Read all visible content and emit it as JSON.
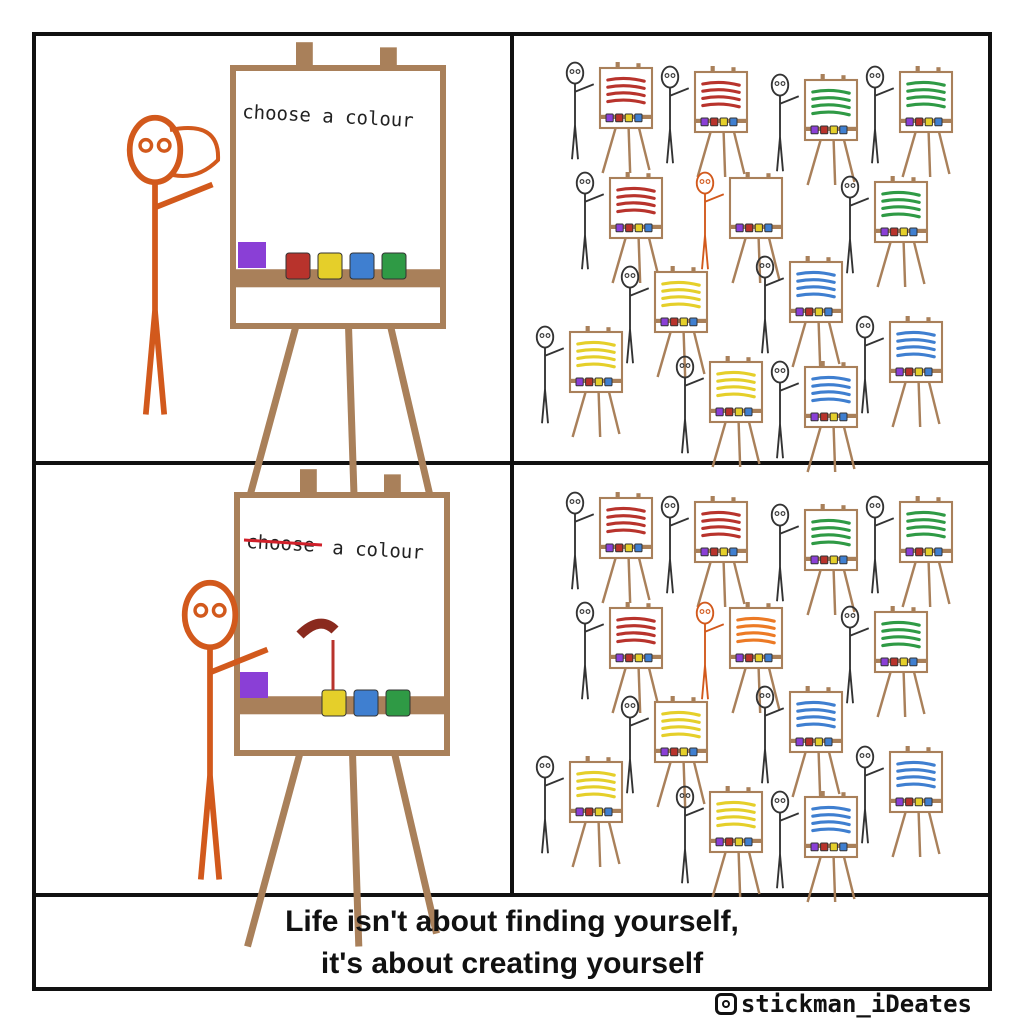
{
  "panels": {
    "top_left": {
      "easel_text": "choose a colour"
    },
    "bottom_left": {
      "easel_text_struck": "choose",
      "easel_text_rest": "a colour"
    }
  },
  "caption": {
    "line1": "Life isn't about finding yourself,",
    "line2": "it's about creating yourself"
  },
  "watermark": {
    "icon": "instagram-icon",
    "handle": "stickman_iDeates"
  },
  "colors": {
    "protagonist": "#d2591c",
    "wood": "#a9805a",
    "red": "#b8332c",
    "yellow": "#e5cf2a",
    "blue": "#3f7fd0",
    "green": "#2f9a45",
    "purple": "#8a3fd6",
    "orange": "#ec7a25",
    "strike": "#d0202a"
  },
  "crowd_paint": [
    "red",
    "red",
    "green",
    "green",
    "red",
    "none",
    "green",
    "yellow",
    "blue",
    "yellow",
    "yellow",
    "blue",
    "blue"
  ],
  "crowd_paint_after": [
    "red",
    "red",
    "green",
    "green",
    "red",
    "orange",
    "green",
    "yellow",
    "blue",
    "yellow",
    "yellow",
    "blue",
    "blue"
  ]
}
